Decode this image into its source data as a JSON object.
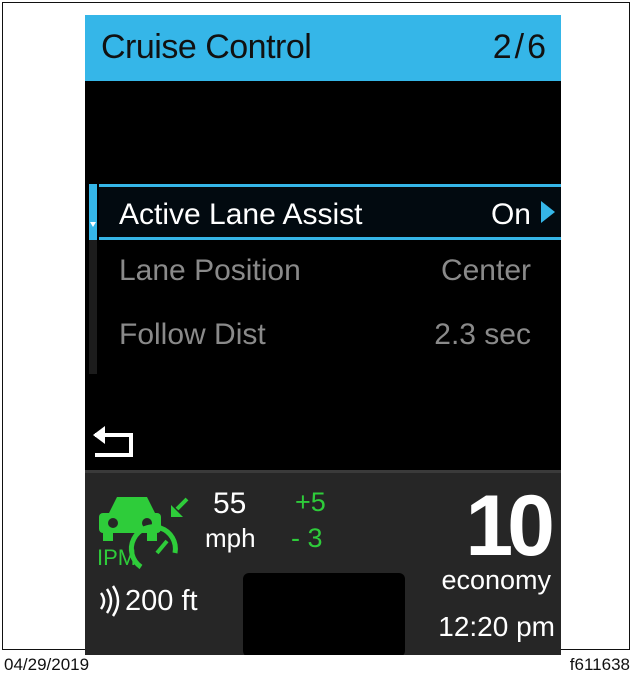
{
  "header": {
    "title": "Cruise Control",
    "page": "2/6"
  },
  "menu": {
    "items": [
      {
        "label": "Active Lane Assist",
        "value": "On",
        "selected": true
      },
      {
        "label": "Lane Position",
        "value": "Center",
        "selected": false
      },
      {
        "label": "Follow Dist",
        "value": "2.3 sec",
        "selected": false
      }
    ]
  },
  "back": {
    "icon": "back-arrow-icon"
  },
  "status": {
    "ipm_label": "IPM",
    "speed": "55",
    "speed_unit": "mph",
    "offset_plus": "+5",
    "offset_minus": "- 3",
    "gear": "10",
    "mode": "economy",
    "clock": "12:20 pm",
    "distance": "200 ft"
  },
  "footer": {
    "date": "04/29/2019",
    "figure_id": "f611638"
  },
  "colors": {
    "accent": "#35b6e8",
    "green": "#2ecc3a"
  }
}
